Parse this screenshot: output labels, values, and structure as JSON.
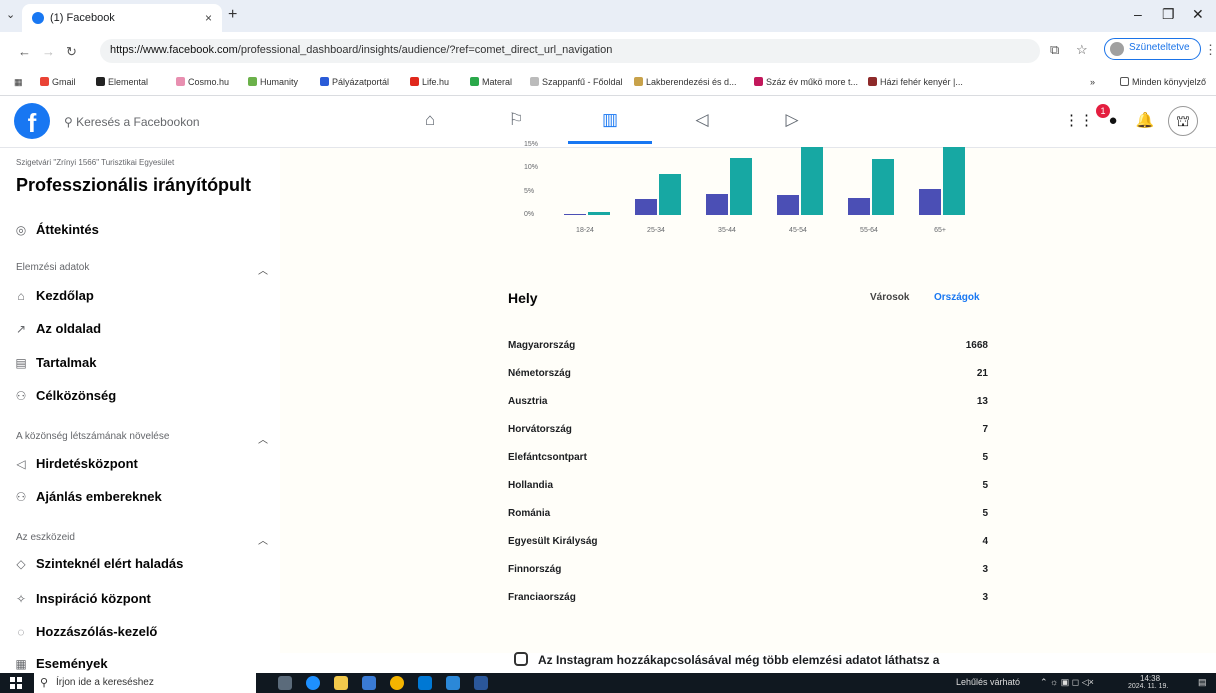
{
  "browser": {
    "tab_title": "(1) Facebook",
    "tab_close": "×",
    "new_tab": "+",
    "url_host": "https://www.facebook.com",
    "url_path": "/professional_dashboard/insights/audience/?ref=comet_direct_url_navigation",
    "pause_label": "Szüneteltetve",
    "bookmarks": [
      "Gmail",
      "Elemental",
      "Cosmo.hu",
      "Humanity",
      "Pályázatportál",
      "Life.hu",
      "Materal",
      "Szappanfű - Főoldal",
      "Lakberendezési és d...",
      "Száz év műkö more t...",
      "Házi fehér kenyér |..."
    ],
    "bookmarks_more": "»",
    "all_bookmarks": "Minden könyvjelző"
  },
  "fb": {
    "logo": "f",
    "search_placeholder": "Keresés a Facebookon",
    "notif_count": "1"
  },
  "sidebar": {
    "org": "Szigetvári \"Zrínyi 1566\" Turisztikai Egyesület",
    "title": "Professzionális irányítópult",
    "overview": "Áttekintés",
    "section_analytics": "Elemzési adatok",
    "home": "Kezdőlap",
    "your_page": "Az oldalad",
    "content": "Tartalmak",
    "audience": "Célközönség",
    "section_grow": "A közönség létszámának növelése",
    "ads_center": "Hirdetésközpont",
    "recommend": "Ajánlás embereknek",
    "section_tools": "Az eszközeid",
    "level_progress": "Szinteknél elért haladás",
    "inspiration": "Inspiráció központ",
    "comment_mgr": "Hozzászólás-kezelő",
    "events": "Események"
  },
  "chart_data": {
    "type": "bar",
    "categories": [
      "18-24",
      "25-34",
      "35-44",
      "45-54",
      "55-64",
      "65+"
    ],
    "series": [
      {
        "values": [
          0.2,
          3.5,
          4.5,
          4.3,
          3.7,
          5.5
        ]
      },
      {
        "values": [
          0.6,
          8.8,
          12.2,
          14.5,
          11.9,
          14.5
        ]
      }
    ],
    "yticks": [
      "15%",
      "10%",
      "5%",
      "0%"
    ],
    "ylim": [
      0,
      15
    ],
    "colors": [
      "#4b4fb5",
      "#17a8a3"
    ]
  },
  "location": {
    "title": "Hely",
    "tab_cities": "Városok",
    "tab_countries": "Országok",
    "rows": [
      {
        "country": "Magyarország",
        "count": "1668"
      },
      {
        "country": "Németország",
        "count": "21"
      },
      {
        "country": "Ausztria",
        "count": "13"
      },
      {
        "country": "Horvátország",
        "count": "7"
      },
      {
        "country": "Elefántcsontpart",
        "count": "5"
      },
      {
        "country": "Hollandia",
        "count": "5"
      },
      {
        "country": "Románia",
        "count": "5"
      },
      {
        "country": "Egyesült Királyság",
        "count": "4"
      },
      {
        "country": "Finnország",
        "count": "3"
      },
      {
        "country": "Franciaország",
        "count": "3"
      }
    ],
    "instagram_note": "Az Instagram hozzákapcsolásával még több elemzési adatot láthatsz a"
  },
  "taskbar": {
    "search_placeholder": "Írjon ide a kereséshez",
    "status": "Lehűlés várható",
    "time": "14:38",
    "date": "2024. 11. 19."
  }
}
